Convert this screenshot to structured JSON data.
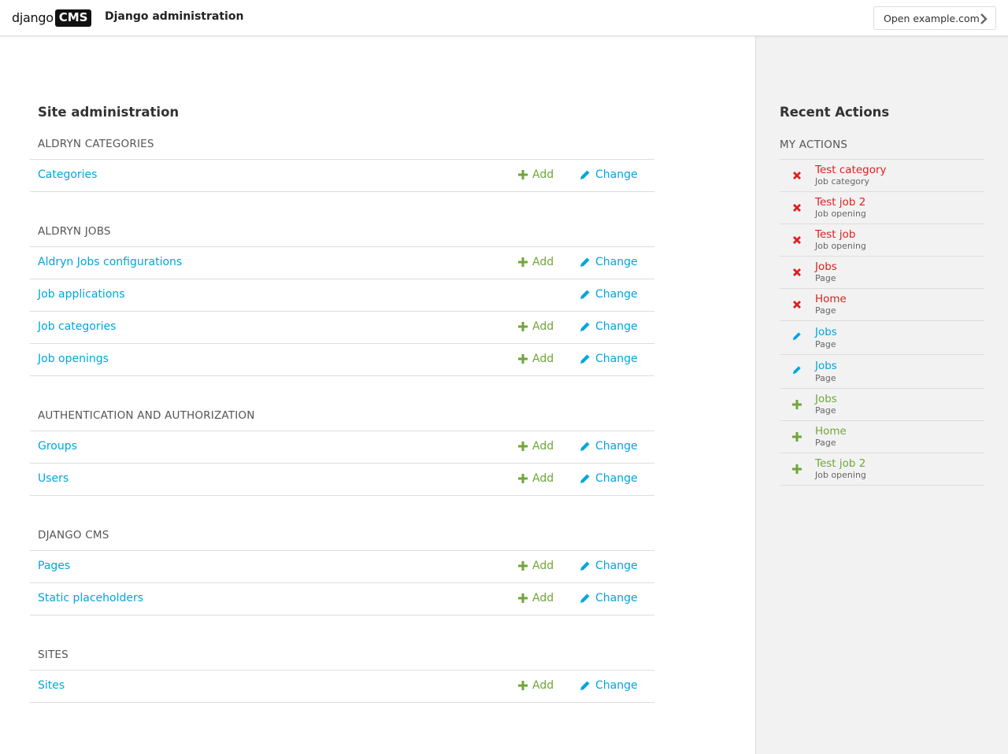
{
  "header": {
    "logo_text": "django",
    "logo_badge": "CMS",
    "title": "Django administration",
    "open_site_label": "Open example.com"
  },
  "page_title": "Site administration",
  "colors": {
    "link": "#00a6de",
    "add": "#6fa63a",
    "delete": "#dd1f1f",
    "sidebar_bg": "#f2f2f2"
  },
  "modules": [
    {
      "caption": "ALDRYN CATEGORIES",
      "models": [
        {
          "name": "Categories",
          "add": "Add",
          "change": "Change"
        }
      ]
    },
    {
      "caption": "ALDRYN JOBS",
      "models": [
        {
          "name": "Aldryn Jobs configurations",
          "add": "Add",
          "change": "Change"
        },
        {
          "name": "Job applications",
          "change": "Change"
        },
        {
          "name": "Job categories",
          "add": "Add",
          "change": "Change"
        },
        {
          "name": "Job openings",
          "add": "Add",
          "change": "Change"
        }
      ]
    },
    {
      "caption": "AUTHENTICATION AND AUTHORIZATION",
      "models": [
        {
          "name": "Groups",
          "add": "Add",
          "change": "Change"
        },
        {
          "name": "Users",
          "add": "Add",
          "change": "Change"
        }
      ]
    },
    {
      "caption": "DJANGO CMS",
      "models": [
        {
          "name": "Pages",
          "add": "Add",
          "change": "Change"
        },
        {
          "name": "Static placeholders",
          "add": "Add",
          "change": "Change"
        }
      ]
    },
    {
      "caption": "SITES",
      "models": [
        {
          "name": "Sites",
          "add": "Add",
          "change": "Change"
        }
      ]
    }
  ],
  "recent_actions": {
    "title": "Recent Actions",
    "subtitle": "MY ACTIONS",
    "items": [
      {
        "action": "delete",
        "icon": "delete-icon",
        "name": "Test category",
        "type": "Job category"
      },
      {
        "action": "delete",
        "icon": "delete-icon",
        "name": "Test job 2",
        "type": "Job opening"
      },
      {
        "action": "delete",
        "icon": "delete-icon",
        "name": "Test job",
        "type": "Job opening"
      },
      {
        "action": "delete",
        "icon": "delete-icon",
        "name": "Jobs",
        "type": "Page"
      },
      {
        "action": "delete",
        "icon": "delete-icon",
        "name": "Home",
        "type": "Page"
      },
      {
        "action": "change",
        "icon": "pencil-icon",
        "name": "Jobs",
        "type": "Page"
      },
      {
        "action": "change",
        "icon": "pencil-icon",
        "name": "Jobs",
        "type": "Page"
      },
      {
        "action": "add",
        "icon": "plus-icon",
        "name": "Jobs",
        "type": "Page"
      },
      {
        "action": "add",
        "icon": "plus-icon",
        "name": "Home",
        "type": "Page"
      },
      {
        "action": "add",
        "icon": "plus-icon",
        "name": "Test job 2",
        "type": "Job opening"
      }
    ]
  }
}
